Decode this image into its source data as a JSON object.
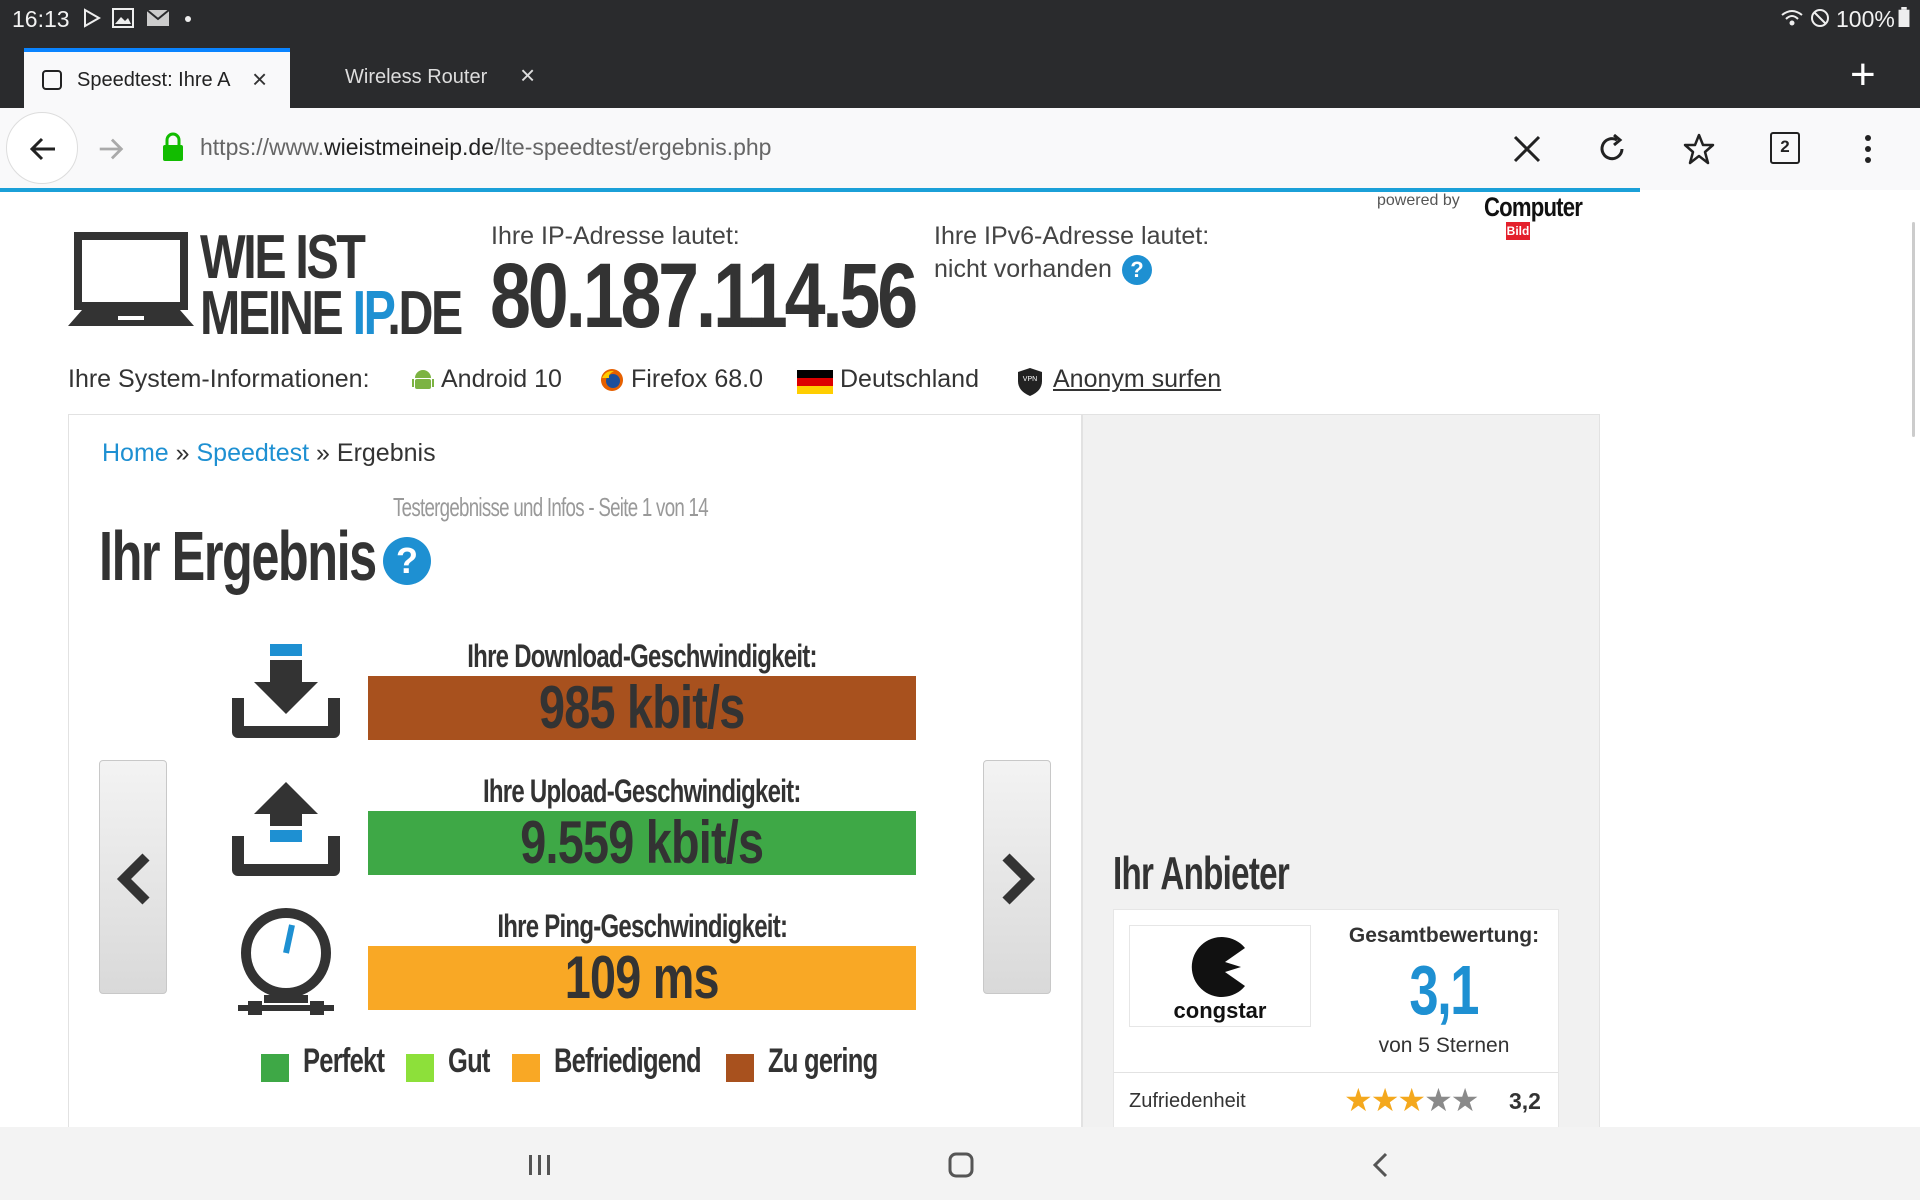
{
  "status_bar": {
    "time": "16:13",
    "battery": "100%"
  },
  "tabs": [
    {
      "title": "Speedtest: Ihre A",
      "active": true
    },
    {
      "title": "Wireless Router",
      "active": false
    }
  ],
  "tab_count": "2",
  "url": {
    "prefix": "https://www.",
    "domain": "wieistmeineip.de",
    "path": "/lte-speedtest/ergebnis.php"
  },
  "header": {
    "logo_line1": "WIE IST",
    "logo_line2a": "MEINE ",
    "logo_line2b": "IP",
    "logo_line2c": ".DE",
    "ip_label": "Ihre IP-Adresse lautet:",
    "ip_value": "80.187.114.56",
    "ipv6_label": "Ihre IPv6-Adresse lautet:",
    "ipv6_value": "nicht vorhanden",
    "powered_by": "powered by",
    "brand_top": "Computer",
    "brand_bottom": "Bild"
  },
  "sysinfo": {
    "label": "Ihre System-Informationen:",
    "os": "Android 10",
    "browser": "Firefox 68.0",
    "country": "Deutschland",
    "vpn_link": "Anonym surfen"
  },
  "breadcrumb": {
    "home": "Home",
    "sep": "»",
    "speedtest": "Speedtest",
    "current": "Ergebnis"
  },
  "pager_hint": "Testergebnisse und Infos - Seite 1 von 14",
  "result_title": "Ihr Ergebnis",
  "results": {
    "download_label": "Ihre Download-Geschwindigkeit:",
    "download_value": "985 kbit/s",
    "upload_label": "Ihre Upload-Geschwindigkeit:",
    "upload_value": "9.559 kbit/s",
    "ping_label": "Ihre Ping-Geschwindigkeit:",
    "ping_value": "109 ms"
  },
  "legend": [
    {
      "label": "Perfekt",
      "color": "#3ea846"
    },
    {
      "label": "Gut",
      "color": "#8de03a"
    },
    {
      "label": "Befriedigend",
      "color": "#f9a825"
    },
    {
      "label": "Zu gering",
      "color": "#a8511e"
    }
  ],
  "colors": {
    "download": "#a8511e",
    "upload": "#3ea846",
    "ping": "#f9a825",
    "accent": "#1e90d2"
  },
  "provider": {
    "heading": "Ihr Anbieter",
    "name": "congstar",
    "overall_label": "Gesamtbewertung:",
    "overall_value": "3,1",
    "overall_sub": "von 5 Sternen",
    "row_label": "Zufriedenheit",
    "row_value": "3,2",
    "row_stars": 3
  }
}
